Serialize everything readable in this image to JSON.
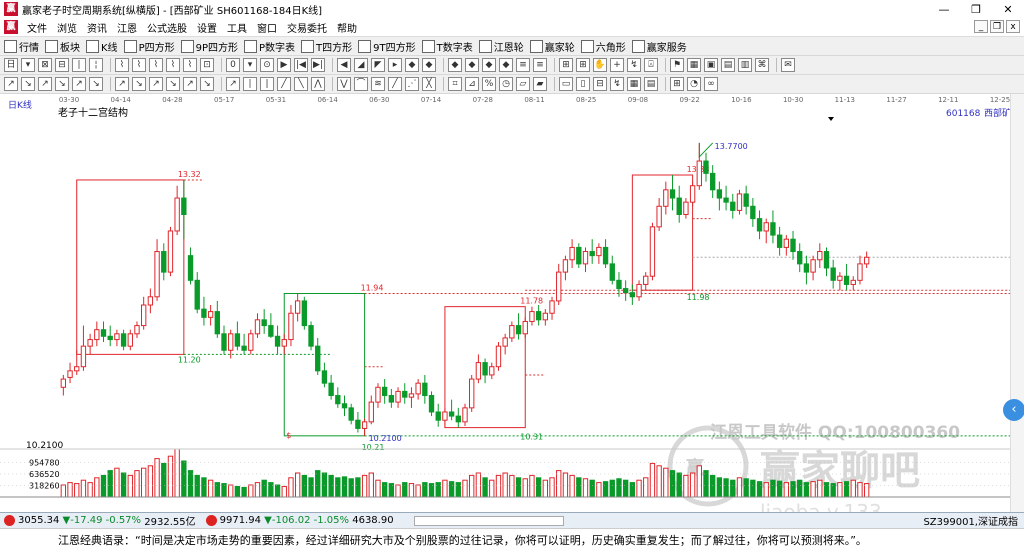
{
  "window": {
    "title": "赢家老子时空周期系统[纵横版] - [西部矿业  SH601168-184日K线]",
    "controls": [
      "—",
      "❐",
      "✕"
    ]
  },
  "menu": {
    "items": [
      "文件",
      "浏览",
      "资讯",
      "江恩",
      "公式选股",
      "设置",
      "工具",
      "窗口",
      "交易委托",
      "帮助"
    ],
    "mdi_controls": [
      "_",
      "❐",
      "x"
    ]
  },
  "toolbar1": {
    "items": [
      {
        "label": "行情",
        "icon": "grid-icon"
      },
      {
        "label": "板块",
        "icon": "blocks-icon"
      },
      {
        "label": "K线",
        "icon": "candle-icon"
      },
      {
        "label": "P四方形",
        "icon": "p-square-icon"
      },
      {
        "label": "9P四方形",
        "icon": "9p-square-icon"
      },
      {
        "label": "P数字表",
        "icon": "p-table-icon"
      },
      {
        "label": "T四方形",
        "icon": "t-square-icon"
      },
      {
        "label": "9T四方形",
        "icon": "9t-square-icon"
      },
      {
        "label": "T数字表",
        "icon": "t-table-icon"
      },
      {
        "label": "江恩轮",
        "icon": "wheel-icon"
      },
      {
        "label": "赢家轮",
        "icon": "wheel2-icon"
      },
      {
        "label": "六角形",
        "icon": "hexagon-icon"
      },
      {
        "label": "赢家服务",
        "icon": "dollar-icon"
      }
    ]
  },
  "toolbar2": {
    "items": [
      "日",
      "▾",
      "⊠",
      "⊟",
      "∣",
      "¦",
      "⌇",
      "⌇",
      "⌇",
      "⌇",
      "⌇",
      "⊡",
      "0",
      "▾",
      "⊙",
      "▶",
      "|◀",
      "▶|",
      "◀",
      "◢",
      "◤",
      "▸",
      "◆",
      "◆",
      "◆",
      "◆",
      "◆",
      "◆",
      "≡",
      "≡",
      "⊞",
      "⊞",
      "✋",
      "+",
      "↯",
      "⍓",
      "⚑",
      "▦",
      "▣",
      "▤",
      "▥",
      "⌘",
      "✉"
    ]
  },
  "toolbar3": {
    "items": [
      "↗",
      "↘",
      "↗",
      "↘",
      "↗",
      "↘",
      "↗",
      "↘",
      "↗",
      "↘",
      "↗",
      "↘",
      "↗",
      "∣",
      "|",
      "╱",
      "╲",
      "⋀",
      "⋁",
      "⌒",
      "≋",
      "╱",
      "⋰",
      "╳",
      "⌗",
      "⊿",
      "%",
      "◷",
      "▱",
      "▰",
      "▭",
      "▯",
      "⊟",
      "↯",
      "▦",
      "▤",
      "⊞",
      "◔",
      "∞"
    ]
  },
  "chart_labels": {
    "period_label": "日K线",
    "indicator_name": "老子十二宫结构",
    "stock_code": "601168",
    "stock_name": "西部矿业",
    "dates": [
      "03-30",
      "04-14",
      "04-28",
      "05-17",
      "05-31",
      "06-14",
      "06-30",
      "07-14",
      "07-28",
      "08-11",
      "08-25",
      "09-08",
      "09-22",
      "10-16",
      "10-30",
      "11-13",
      "11-27",
      "12-11",
      "12-25"
    ],
    "price_marks": [
      "13.32",
      "11.20",
      "11.94",
      "10.2100",
      "10.21",
      "11.78",
      "10.31",
      "13.38",
      "11.98",
      "13.7700",
      "$"
    ],
    "volume_axis": [
      "954780",
      "636520",
      "318260"
    ],
    "left_axis_price": "10.2100",
    "watermark_1": "江恩工具软件  QQ:100800360",
    "watermark_2": "赢家聊吧",
    "watermark_3": "liaoba.v.133"
  },
  "chart_data": {
    "type": "candlestick",
    "title": "老子十二宫结构",
    "symbol": "SH601168",
    "name": "西部矿业",
    "period": "日K线",
    "x_ticks": [
      "03-30",
      "04-14",
      "04-28",
      "05-17",
      "05-31",
      "06-14",
      "06-30",
      "07-14",
      "07-28",
      "08-11",
      "08-25",
      "09-08",
      "09-22",
      "10-16",
      "10-30",
      "11-13",
      "11-27",
      "12-11",
      "12-25"
    ],
    "ylim": [
      10.05,
      14.0
    ],
    "volume_ticks": [
      954780,
      636520,
      318260
    ],
    "candles": [
      [
        10.8,
        10.95,
        10.9,
        10.7
      ],
      [
        10.92,
        11.1,
        11.0,
        10.85
      ],
      [
        11.0,
        11.25,
        11.05,
        10.95
      ],
      [
        11.05,
        11.55,
        11.3,
        11.0
      ],
      [
        11.3,
        11.45,
        11.38,
        11.2
      ],
      [
        11.38,
        11.6,
        11.5,
        11.3
      ],
      [
        11.5,
        11.6,
        11.42,
        11.35
      ],
      [
        11.42,
        11.55,
        11.38,
        11.3
      ],
      [
        11.38,
        11.5,
        11.45,
        11.3
      ],
      [
        11.45,
        11.5,
        11.3,
        11.25
      ],
      [
        11.3,
        11.5,
        11.45,
        11.25
      ],
      [
        11.45,
        11.6,
        11.55,
        11.4
      ],
      [
        11.55,
        11.9,
        11.8,
        11.5
      ],
      [
        11.8,
        12.0,
        11.9,
        11.7
      ],
      [
        11.9,
        12.6,
        12.45,
        11.85
      ],
      [
        12.45,
        12.55,
        12.2,
        12.1
      ],
      [
        12.2,
        12.75,
        12.7,
        12.15
      ],
      [
        12.7,
        13.25,
        13.1,
        12.65
      ],
      [
        13.1,
        13.32,
        12.9,
        12.6
      ],
      [
        12.4,
        12.5,
        12.1,
        12.05
      ],
      [
        12.1,
        12.2,
        11.75,
        11.7
      ],
      [
        11.75,
        11.9,
        11.65,
        11.55
      ],
      [
        11.65,
        11.8,
        11.72,
        11.55
      ],
      [
        11.72,
        11.85,
        11.45,
        11.4
      ],
      [
        11.45,
        11.55,
        11.25,
        11.2
      ],
      [
        11.25,
        11.5,
        11.45,
        11.15
      ],
      [
        11.45,
        11.6,
        11.3,
        11.25
      ],
      [
        11.3,
        11.45,
        11.25,
        11.2
      ],
      [
        11.25,
        11.5,
        11.45,
        11.2
      ],
      [
        11.45,
        11.7,
        11.62,
        11.4
      ],
      [
        11.62,
        11.75,
        11.55,
        11.45
      ],
      [
        11.55,
        11.7,
        11.42,
        11.4
      ],
      [
        11.42,
        11.55,
        11.3,
        11.2
      ],
      [
        11.3,
        11.45,
        11.38,
        11.2
      ],
      [
        11.38,
        11.8,
        11.7,
        11.3
      ],
      [
        11.7,
        11.94,
        11.85,
        11.6
      ],
      [
        11.85,
        11.9,
        11.55,
        11.5
      ],
      [
        11.55,
        11.6,
        11.3,
        11.25
      ],
      [
        11.3,
        11.4,
        11.0,
        10.95
      ],
      [
        11.0,
        11.1,
        10.85,
        10.8
      ],
      [
        10.85,
        10.95,
        10.7,
        10.65
      ],
      [
        10.7,
        10.8,
        10.6,
        10.55
      ],
      [
        10.6,
        10.7,
        10.55,
        10.45
      ],
      [
        10.55,
        10.6,
        10.4,
        10.35
      ],
      [
        10.4,
        10.5,
        10.3,
        10.25
      ],
      [
        10.3,
        10.42,
        10.38,
        10.21
      ],
      [
        10.38,
        10.7,
        10.62,
        10.35
      ],
      [
        10.62,
        10.85,
        10.8,
        10.55
      ],
      [
        10.8,
        10.9,
        10.7,
        10.6
      ],
      [
        10.7,
        10.78,
        10.62,
        10.55
      ],
      [
        10.62,
        10.8,
        10.75,
        10.55
      ],
      [
        10.75,
        10.85,
        10.68,
        10.6
      ],
      [
        10.68,
        10.8,
        10.72,
        10.55
      ],
      [
        10.72,
        10.9,
        10.85,
        10.65
      ],
      [
        10.85,
        10.95,
        10.7,
        10.6
      ],
      [
        10.7,
        10.75,
        10.5,
        10.45
      ],
      [
        10.5,
        10.6,
        10.4,
        10.32
      ],
      [
        10.4,
        10.55,
        10.5,
        10.31
      ],
      [
        10.5,
        10.65,
        10.45,
        10.4
      ],
      [
        10.45,
        10.55,
        10.38,
        10.31
      ],
      [
        10.38,
        10.6,
        10.55,
        10.33
      ],
      [
        10.55,
        10.95,
        10.9,
        10.5
      ],
      [
        10.9,
        11.2,
        11.1,
        10.85
      ],
      [
        11.1,
        11.15,
        10.95,
        10.85
      ],
      [
        10.95,
        11.1,
        11.05,
        10.9
      ],
      [
        11.05,
        11.35,
        11.3,
        11.0
      ],
      [
        11.3,
        11.45,
        11.4,
        11.2
      ],
      [
        11.4,
        11.6,
        11.55,
        11.35
      ],
      [
        11.55,
        11.7,
        11.45,
        11.38
      ],
      [
        11.45,
        11.65,
        11.6,
        11.4
      ],
      [
        11.6,
        11.78,
        11.72,
        11.55
      ],
      [
        11.72,
        11.8,
        11.62,
        11.55
      ],
      [
        11.62,
        11.75,
        11.7,
        11.55
      ],
      [
        11.7,
        11.9,
        11.85,
        11.62
      ],
      [
        11.85,
        12.3,
        12.2,
        11.8
      ],
      [
        12.2,
        12.4,
        12.35,
        12.1
      ],
      [
        12.35,
        12.6,
        12.5,
        12.25
      ],
      [
        12.5,
        12.55,
        12.3,
        12.25
      ],
      [
        12.3,
        12.5,
        12.45,
        12.2
      ],
      [
        12.45,
        12.6,
        12.4,
        12.3
      ],
      [
        12.4,
        12.55,
        12.5,
        12.3
      ],
      [
        12.5,
        12.6,
        12.3,
        12.25
      ],
      [
        12.3,
        12.4,
        12.1,
        12.05
      ],
      [
        12.1,
        12.2,
        12.0,
        11.9
      ],
      [
        12.0,
        12.1,
        11.95,
        11.85
      ],
      [
        11.95,
        12.05,
        11.9,
        11.8
      ],
      [
        11.9,
        12.1,
        12.05,
        11.85
      ],
      [
        12.05,
        12.2,
        12.15,
        11.98
      ],
      [
        12.15,
        12.8,
        12.75,
        12.1
      ],
      [
        12.75,
        13.1,
        13.0,
        12.7
      ],
      [
        13.0,
        13.3,
        13.2,
        12.9
      ],
      [
        13.2,
        13.38,
        13.1,
        12.95
      ],
      [
        13.1,
        13.25,
        12.9,
        12.8
      ],
      [
        12.9,
        13.1,
        13.05,
        12.85
      ],
      [
        13.05,
        13.3,
        13.25,
        13.0
      ],
      [
        13.25,
        13.77,
        13.55,
        13.2
      ],
      [
        13.55,
        13.65,
        13.4,
        13.3
      ],
      [
        13.4,
        13.5,
        13.2,
        13.1
      ],
      [
        13.2,
        13.3,
        13.1,
        12.95
      ],
      [
        13.1,
        13.25,
        13.05,
        12.95
      ],
      [
        13.05,
        13.15,
        12.95,
        12.85
      ],
      [
        12.95,
        13.2,
        13.15,
        12.9
      ],
      [
        13.15,
        13.25,
        13.0,
        12.9
      ],
      [
        13.0,
        13.1,
        12.85,
        12.75
      ],
      [
        12.85,
        12.95,
        12.7,
        12.6
      ],
      [
        12.7,
        12.85,
        12.8,
        12.55
      ],
      [
        12.8,
        12.95,
        12.65,
        12.55
      ],
      [
        12.65,
        12.75,
        12.5,
        12.4
      ],
      [
        12.5,
        12.65,
        12.6,
        12.4
      ],
      [
        12.6,
        12.7,
        12.45,
        12.35
      ],
      [
        12.45,
        12.55,
        12.3,
        12.2
      ],
      [
        12.3,
        12.4,
        12.2,
        12.05
      ],
      [
        12.2,
        12.4,
        12.35,
        12.1
      ],
      [
        12.35,
        12.55,
        12.45,
        12.25
      ],
      [
        12.45,
        12.5,
        12.25,
        12.15
      ],
      [
        12.25,
        12.35,
        12.1,
        12.0
      ],
      [
        12.1,
        12.2,
        12.15,
        11.98
      ],
      [
        12.15,
        12.3,
        12.05,
        11.98
      ],
      [
        12.05,
        12.15,
        12.1,
        11.98
      ],
      [
        12.1,
        12.4,
        12.3,
        12.05
      ],
      [
        12.3,
        12.45,
        12.38,
        12.25
      ]
    ],
    "volumes": [
      0.25,
      0.3,
      0.28,
      0.35,
      0.3,
      0.4,
      0.45,
      0.55,
      0.6,
      0.5,
      0.45,
      0.55,
      0.6,
      0.65,
      0.8,
      0.7,
      0.85,
      1.0,
      0.75,
      0.55,
      0.45,
      0.4,
      0.35,
      0.3,
      0.28,
      0.25,
      0.22,
      0.2,
      0.25,
      0.3,
      0.35,
      0.3,
      0.25,
      0.22,
      0.4,
      0.5,
      0.45,
      0.4,
      0.55,
      0.5,
      0.45,
      0.4,
      0.42,
      0.38,
      0.4,
      0.45,
      0.5,
      0.35,
      0.3,
      0.28,
      0.25,
      0.3,
      0.28,
      0.25,
      0.3,
      0.28,
      0.3,
      0.35,
      0.32,
      0.3,
      0.35,
      0.45,
      0.5,
      0.4,
      0.35,
      0.45,
      0.5,
      0.45,
      0.4,
      0.38,
      0.45,
      0.4,
      0.35,
      0.4,
      0.55,
      0.5,
      0.45,
      0.4,
      0.38,
      0.35,
      0.3,
      0.32,
      0.35,
      0.38,
      0.35,
      0.3,
      0.35,
      0.4,
      0.7,
      0.65,
      0.6,
      0.55,
      0.5,
      0.45,
      0.5,
      0.65,
      0.55,
      0.45,
      0.4,
      0.38,
      0.35,
      0.4,
      0.38,
      0.35,
      0.32,
      0.3,
      0.35,
      0.33,
      0.3,
      0.32,
      0.35,
      0.3,
      0.32,
      0.35,
      0.3,
      0.28,
      0.3,
      0.32,
      0.35,
      0.3,
      0.28
    ]
  },
  "status": {
    "sh_index": "3055.34",
    "sh_change": "▼-17.49",
    "sh_pct": "-0.57%",
    "sh_amount": "2932.55亿",
    "sz_index": "9971.94",
    "sz_change": "▼-106.02",
    "sz_pct": "-1.05%",
    "sz_amount": "4638.90",
    "right_text": "SZ399001,深证成指"
  },
  "quote": {
    "text": "江恩经典语录：“时间是决定市场走势的重要因素，经过详细研究大市及个别股票的过往记录，你将可以证明，历史确实重复发生；而了解过往，你将可以预测将来。”。"
  },
  "colors": {
    "up": "#e0262b",
    "down": "#0a9a2a",
    "dotted_red": "#d83030",
    "blue_label": "#3030c0"
  }
}
